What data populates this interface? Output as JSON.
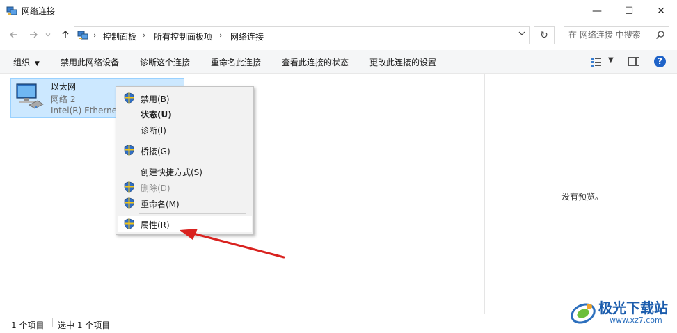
{
  "window": {
    "title": "网络连接",
    "controls": {
      "minimize": "—",
      "maximize": "☐",
      "close": "✕"
    }
  },
  "nav": {
    "back_icon": "arrow-left-icon",
    "forward_icon": "arrow-right-icon",
    "recent_icon": "chevron-down-icon",
    "up_icon": "arrow-up-icon",
    "breadcrumb": [
      "控制面板",
      "所有控制面板项",
      "网络连接"
    ],
    "refresh_glyph": "↻",
    "search_placeholder": "在 网络连接 中搜索"
  },
  "toolbar": {
    "items": [
      "组织",
      "禁用此网络设备",
      "诊断这个连接",
      "重命名此连接",
      "查看此连接的状态",
      "更改此连接的设置"
    ],
    "help": "?"
  },
  "network_item": {
    "name": "以太网",
    "network": "网络 2",
    "adapter": "Intel(R) Ethernet"
  },
  "context_menu": {
    "items": [
      {
        "label": "禁用(B)",
        "icon": "shield-icon"
      },
      {
        "label": "状态(U)",
        "bold": true
      },
      {
        "label": "诊断(I)"
      },
      {
        "label": "桥接(G)",
        "icon": "shield-icon"
      },
      {
        "label": "创建快捷方式(S)"
      },
      {
        "label": "删除(D)",
        "icon": "shield-icon",
        "disabled": true
      },
      {
        "label": "重命名(M)",
        "icon": "shield-icon"
      },
      {
        "label": "属性(R)",
        "icon": "shield-icon",
        "highlighted": true
      }
    ]
  },
  "preview": {
    "text": "没有预览。"
  },
  "status": {
    "count": "1 个项目",
    "selected": "选中 1 个项目"
  },
  "watermark": {
    "name": "极光下载站",
    "url": "www.xz7.com"
  },
  "colors": {
    "selection": "#cce8ff",
    "annotation_arrow": "#d9221f",
    "help": "#1f63c8"
  }
}
